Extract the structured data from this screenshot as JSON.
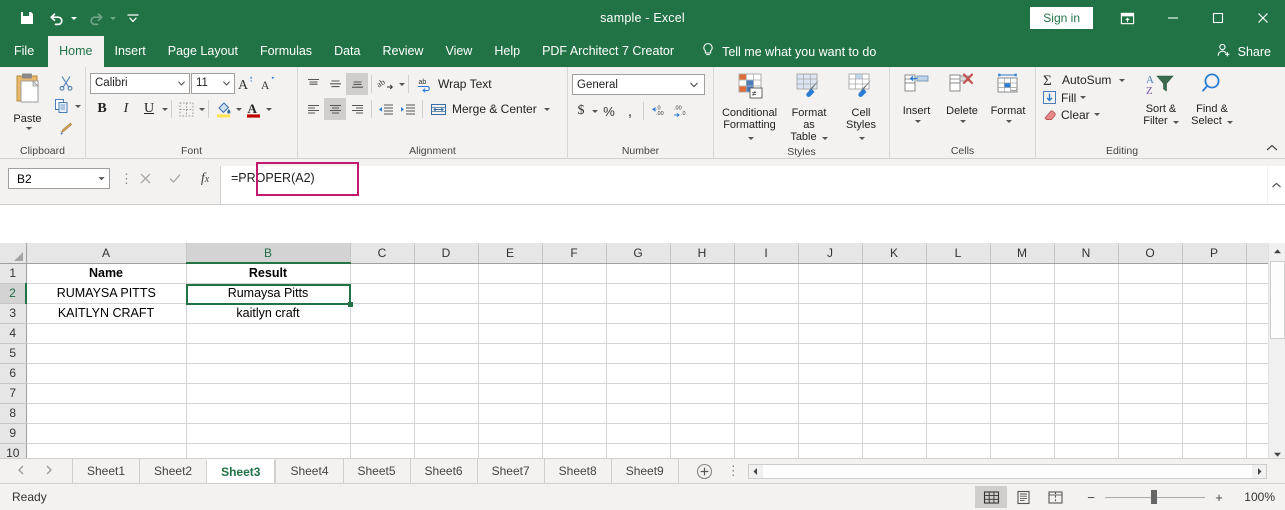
{
  "titlebar": {
    "app_title": "sample  -  Excel",
    "signin_label": "Sign in",
    "qat": [
      {
        "name": "save-icon",
        "label": "Save"
      },
      {
        "name": "undo-icon",
        "label": "Undo"
      },
      {
        "name": "redo-icon",
        "label": "Redo"
      },
      {
        "name": "customize-quick-access-toolbar-icon",
        "label": "Customize Quick Access Toolbar"
      }
    ],
    "window_controls": {
      "ribbon_display": "Ribbon Display Options",
      "minimize": "Minimize",
      "maximize": "Restore Down",
      "close": "Close"
    }
  },
  "ribbon_tabs": [
    {
      "label": "File",
      "active": false
    },
    {
      "label": "Home",
      "active": true
    },
    {
      "label": "Insert",
      "active": false
    },
    {
      "label": "Page Layout",
      "active": false
    },
    {
      "label": "Formulas",
      "active": false
    },
    {
      "label": "Data",
      "active": false
    },
    {
      "label": "Review",
      "active": false
    },
    {
      "label": "View",
      "active": false
    },
    {
      "label": "Help",
      "active": false
    },
    {
      "label": "PDF Architect 7 Creator",
      "active": false
    }
  ],
  "tellme": {
    "label": "Tell me what you want to do"
  },
  "share": {
    "label": "Share"
  },
  "ribbon": {
    "clipboard": {
      "group_label": "Clipboard",
      "paste_label": "Paste",
      "cut_label": "Cut",
      "copy_label": "Copy",
      "format_painter_label": "Format Painter"
    },
    "font": {
      "group_label": "Font",
      "font_family": "Calibri",
      "font_size": "11",
      "grow_font": "Increase Font Size",
      "shrink_font": "Decrease Font Size",
      "bold": "B",
      "italic": "I",
      "underline": "U",
      "borders": "Borders",
      "fill_color": "Fill Color",
      "font_color": "Font Color"
    },
    "alignment": {
      "group_label": "Alignment",
      "wrap_text_label": "Wrap Text",
      "merge_center_label": "Merge & Center",
      "top_align": "Top Align",
      "middle_align": "Middle Align",
      "bottom_align": "Bottom Align",
      "align_left": "Align Left",
      "center": "Center",
      "align_right": "Align Right",
      "orientation": "Orientation",
      "decrease_indent": "Decrease Indent",
      "increase_indent": "Increase Indent"
    },
    "number": {
      "group_label": "Number",
      "number_format": "General",
      "accounting": "Accounting Number Format",
      "percent": "Percent Style",
      "comma": "Comma Style",
      "increase_decimal": "Increase Decimal",
      "decrease_decimal": "Decrease Decimal"
    },
    "styles": {
      "group_label": "Styles",
      "conditional_formatting_l1": "Conditional",
      "conditional_formatting_l2": "Formatting",
      "format_as_table_l1": "Format as",
      "format_as_table_l2": "Table",
      "cell_styles_l1": "Cell",
      "cell_styles_l2": "Styles"
    },
    "cells": {
      "group_label": "Cells",
      "insert_label": "Insert",
      "delete_label": "Delete",
      "format_label": "Format"
    },
    "editing": {
      "group_label": "Editing",
      "autosum_label": "AutoSum",
      "fill_label": "Fill",
      "clear_label": "Clear",
      "sort_filter_l1": "Sort &",
      "sort_filter_l2": "Filter",
      "find_select_l1": "Find &",
      "find_select_l2": "Select"
    }
  },
  "formula_bar": {
    "name_box_value": "B2",
    "cancel_label": "Cancel",
    "enter_label": "Enter",
    "insert_function_label": "Insert Function",
    "formula_value": "=PROPER(A2)",
    "highlight_color": "#c2186f",
    "expand_label": "Expand Formula Bar"
  },
  "grid": {
    "columns": [
      "A",
      "B",
      "C",
      "D",
      "E",
      "F",
      "G",
      "H",
      "I",
      "J",
      "K",
      "L",
      "M",
      "N",
      "O",
      "P"
    ],
    "selected_column": "B",
    "rows": [
      "1",
      "2",
      "3",
      "4",
      "5",
      "6",
      "7",
      "8",
      "9",
      "10"
    ],
    "selected_row": "2",
    "cells": {
      "A1": "Name",
      "B1": "Result",
      "A2": "RUMAYSA PITTS",
      "B2": "Rumaysa Pitts",
      "A3": "KAITLYN CRAFT",
      "B3": "kaitlyn craft"
    },
    "selection": "B2",
    "selection_color": "#217346"
  },
  "sheet_tabs": {
    "tabs": [
      {
        "label": "Sheet1",
        "active": false
      },
      {
        "label": "Sheet2",
        "active": false
      },
      {
        "label": "Sheet3",
        "active": true
      },
      {
        "label": "Sheet4",
        "active": false
      },
      {
        "label": "Sheet5",
        "active": false
      },
      {
        "label": "Sheet6",
        "active": false
      },
      {
        "label": "Sheet7",
        "active": false
      },
      {
        "label": "Sheet8",
        "active": false
      },
      {
        "label": "Sheet9",
        "active": false
      }
    ],
    "add_sheet_label": "New sheet",
    "prev_label": "Previous sheet",
    "next_label": "Next sheet"
  },
  "statusbar": {
    "status_text": "Ready",
    "view_normal": "Normal",
    "view_page_layout": "Page Layout",
    "view_page_break": "Page Break Preview",
    "zoom_out": "−",
    "zoom_in": "+",
    "zoom_level": "100%"
  }
}
